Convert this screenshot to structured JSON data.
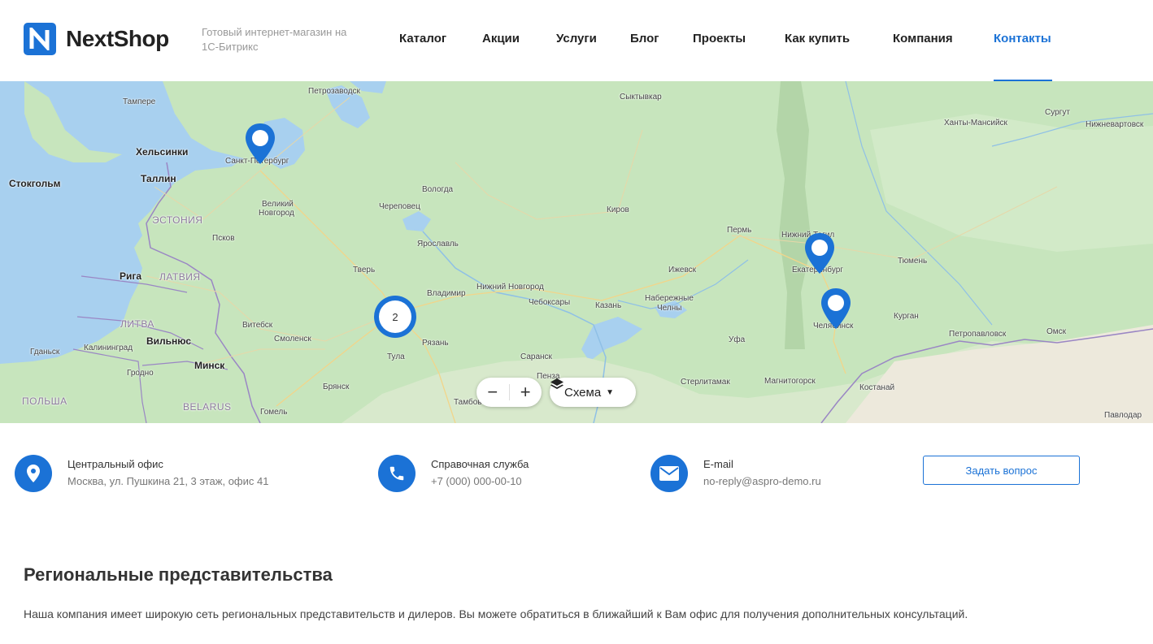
{
  "header": {
    "logo_text": "NextShop",
    "tagline": "Готовый интернет-магазин на 1С-Битрикс",
    "nav": [
      {
        "label": "Каталог"
      },
      {
        "label": "Акции"
      },
      {
        "label": "Услуги"
      },
      {
        "label": "Блог"
      },
      {
        "label": "Проекты"
      },
      {
        "label": "Как купить"
      },
      {
        "label": "Компания"
      },
      {
        "label": "Контакты",
        "active": true
      }
    ]
  },
  "map": {
    "cluster_count": "2",
    "layers_label": "Схема",
    "zoom_out": "−",
    "zoom_in": "+",
    "labels": {
      "tampere": "Тампере",
      "petrozavodsk": "Петрозаводск",
      "syktyvkar": "Сыктывкар",
      "surgut": "Сургут",
      "khanty": "Ханты-Мансийск",
      "nizhnevartovsk": "Нижневартовск",
      "helsinki": "Хельсинки",
      "spb": "Санкт-Петербург",
      "stockholm": "Стокгольм",
      "tallinn": "Таллин",
      "vologda": "Вологда",
      "veliky1": "Великий",
      "veliky2": "Новгород",
      "cherepovets": "Череповец",
      "kirov": "Киров",
      "estonia": "ЭСТОНИЯ",
      "pskov": "Псков",
      "yaroslavl": "Ярославль",
      "perm": "Пермь",
      "nizhny_tagil": "Нижний Тагил",
      "ekb": "Екатеринбург",
      "tyumen": "Тюмень",
      "tver": "Тверь",
      "riga": "Рига",
      "latvia": "ЛАТВИЯ",
      "izhevsk": "Ижевск",
      "vladimir": "Владимир",
      "nnovgorod": "Нижний Новгород",
      "cheboksary": "Чебоксары",
      "kazan": "Казань",
      "chelny1": "Набережные",
      "chelny2": "Челны",
      "chelyabinsk": "Челябинск",
      "kurgan": "Курган",
      "lithuania": "ЛИТВА",
      "vitebsk": "Витебск",
      "smolensk": "Смоленск",
      "vilnius": "Вильнюс",
      "petropavlovsk": "Петропавловск",
      "omsk": "Омск",
      "ryazan": "Рязань",
      "gdansk": "Гданьск",
      "kaliningrad": "Калининград",
      "tula": "Тула",
      "saransk": "Саранск",
      "ufa": "Уфа",
      "minsk": "Минск",
      "grodno": "Гродно",
      "penza": "Пенза",
      "sterlitamak": "Стерлитамак",
      "magnitogorsk": "Магнитогорск",
      "bryansk": "Брянск",
      "kostanay": "Костанай",
      "poland": "ПОЛЬША",
      "belarus": "BELARUS",
      "tambov": "Тамбов",
      "gomel": "Гомель",
      "pavlodar": "Павлодар"
    }
  },
  "contacts": [
    {
      "title": "Центральный офис",
      "value": "Москва, ул. Пушкина 21, 3 этаж, офис 41"
    },
    {
      "title": "Справочная служба",
      "value": "+7 (000) 000-00-10"
    },
    {
      "title": "E-mail",
      "value": "no-reply@aspro-demo.ru"
    }
  ],
  "ask_button": "Задать вопрос",
  "section": {
    "title": "Региональные представительства",
    "text": "Наша компания имеет широкую сеть региональных представительств и дилеров. Вы можете обратиться в ближайший к Вам офис для получения дополнительных консультаций."
  },
  "colors": {
    "accent": "#1b72d6",
    "map_land": "#c7e5bd",
    "map_water": "#a8d0ef"
  }
}
